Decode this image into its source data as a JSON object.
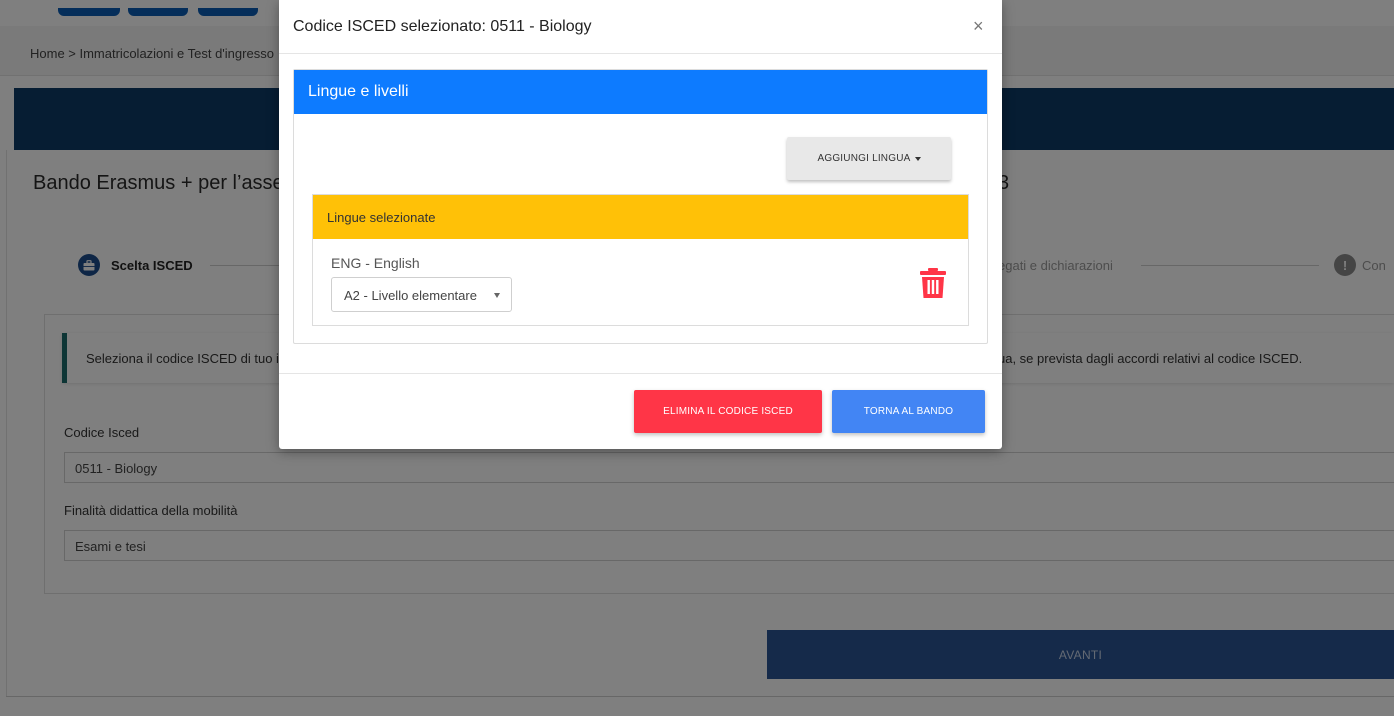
{
  "background": {
    "breadcrumb": "Home > Immatricolazioni e Test d'ingresso",
    "bando_title": "Bando Erasmus + per l’asse",
    "bando_title_tail": "3",
    "stepper": {
      "active_label": "Scelta ISCED",
      "mid_label": "egati e dichiarazioni",
      "last_label": "Con",
      "last_icon_glyph": "!"
    },
    "info_text": "Seleziona il codice ISCED di tuo in",
    "info_text_tail": "ua, se prevista dagli accordi relativi al codice ISCED.",
    "fields": {
      "codice_label": "Codice Isced",
      "codice_value": "0511 - Biology",
      "finalita_label": "Finalità didattica della mobilità",
      "finalita_value": "Esami e tesi"
    },
    "avanti_label": "AVANTI",
    "colors": {
      "hero": "#0d3a66",
      "avanti": "#2a5595"
    }
  },
  "modal": {
    "title": "Codice ISCED selezionato: 0511 - Biology",
    "close_glyph": "×",
    "panel": {
      "heading": "Lingue e livelli",
      "add_language_label": "AGGIUNGI LINGUA",
      "selected_heading": "Lingue selezionate",
      "languages": [
        {
          "name": "ENG - English",
          "level": "A2 - Livello elementare"
        }
      ]
    },
    "buttons": {
      "delete_label": "ELIMINA IL CODICE ISCED",
      "back_label": "TORNA AL BANDO"
    },
    "colors": {
      "panel_heading": "#0d7bff",
      "selected_heading": "#ffc107",
      "delete": "#ff3547",
      "back": "#4285f4",
      "trash": "#ff3547"
    },
    "icons": [
      "close-icon",
      "caret-down-icon",
      "trash-icon"
    ]
  }
}
